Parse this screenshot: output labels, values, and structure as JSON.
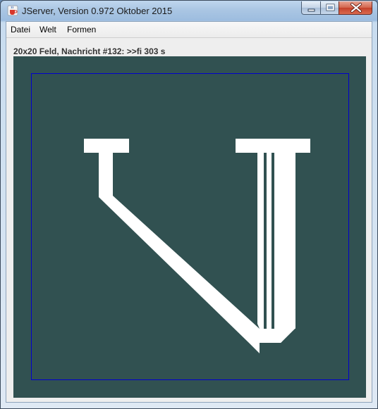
{
  "window": {
    "title": "JServer, Version 0.972 Oktober 2015"
  },
  "menu": {
    "items": [
      "Datei",
      "Welt",
      "Formen"
    ]
  },
  "status": {
    "text": "20x20 Feld, Nachricht #132: >>fi 303 s"
  },
  "board": {
    "background_color": "#315151",
    "border_color": "#0000cc",
    "shape_color": "#ffffff"
  },
  "icons": {
    "app": "java-cup-icon",
    "minimize": "minimize-icon",
    "maximize": "maximize-icon",
    "close": "close-icon"
  }
}
